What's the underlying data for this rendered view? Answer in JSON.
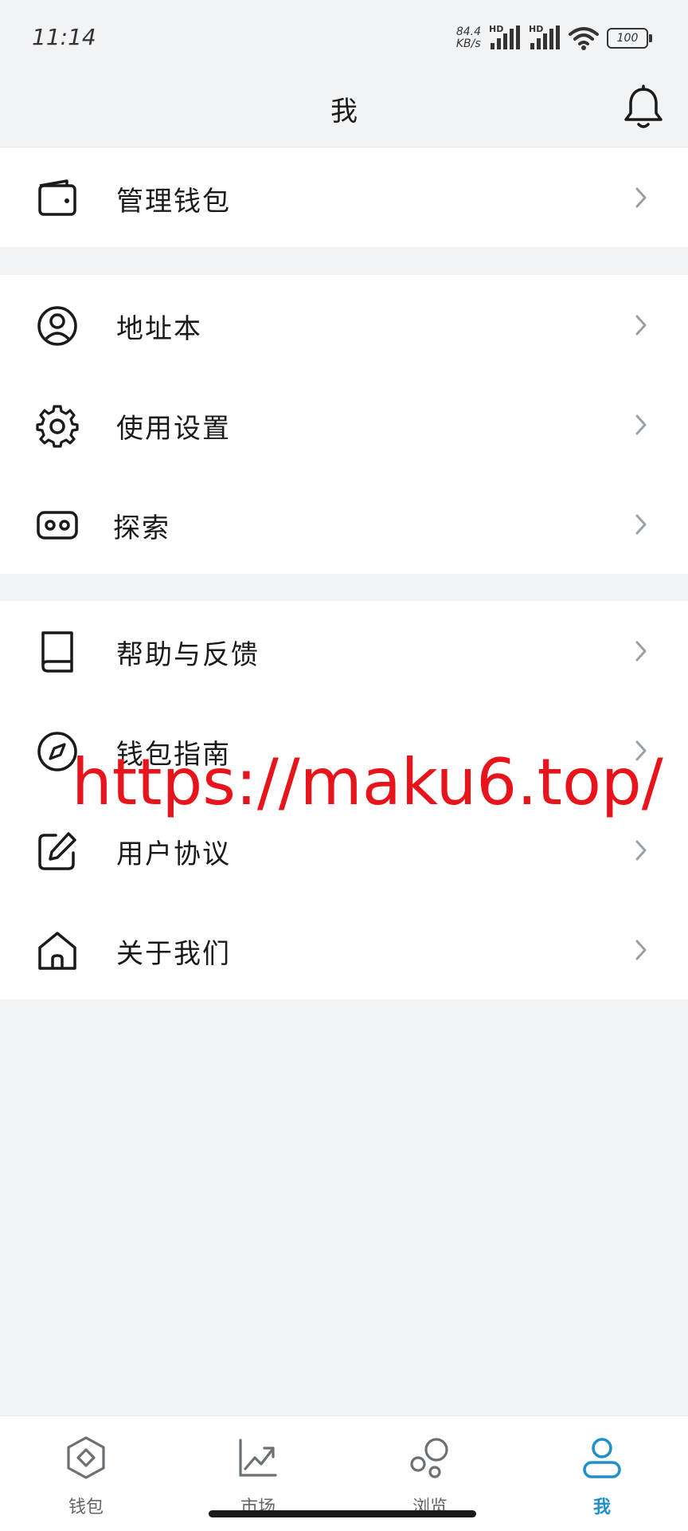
{
  "status": {
    "time": "11:14",
    "net_speed_value": "84.4",
    "net_speed_unit": "KB/s",
    "hd1": "HD",
    "hd2": "HD",
    "battery": "100"
  },
  "header": {
    "title": "我",
    "bell_icon": "bell-icon"
  },
  "menu": {
    "group1": [
      {
        "label": "管理钱包",
        "icon": "wallet-icon"
      }
    ],
    "group2": [
      {
        "label": "地址本",
        "icon": "user-circle-icon"
      },
      {
        "label": "使用设置",
        "icon": "gear-icon"
      },
      {
        "label": "探索",
        "icon": "vr-glasses-icon"
      }
    ],
    "group3": [
      {
        "label": "帮助与反馈",
        "icon": "book-icon"
      },
      {
        "label": "钱包指南",
        "icon": "compass-icon"
      },
      {
        "label": "用户协议",
        "icon": "edit-icon"
      },
      {
        "label": "关于我们",
        "icon": "home-icon"
      }
    ]
  },
  "watermark": "https://maku6.top/",
  "tabs": [
    {
      "label": "钱包",
      "icon": "wallet-diamond-icon",
      "active": false
    },
    {
      "label": "市场",
      "icon": "market-chart-icon",
      "active": false
    },
    {
      "label": "浏览",
      "icon": "browse-bubbles-icon",
      "active": false
    },
    {
      "label": "我",
      "icon": "profile-icon",
      "active": true
    }
  ],
  "colors": {
    "accent": "#1f90c8",
    "watermark": "#e8141b",
    "background": "#f2f3f5"
  }
}
